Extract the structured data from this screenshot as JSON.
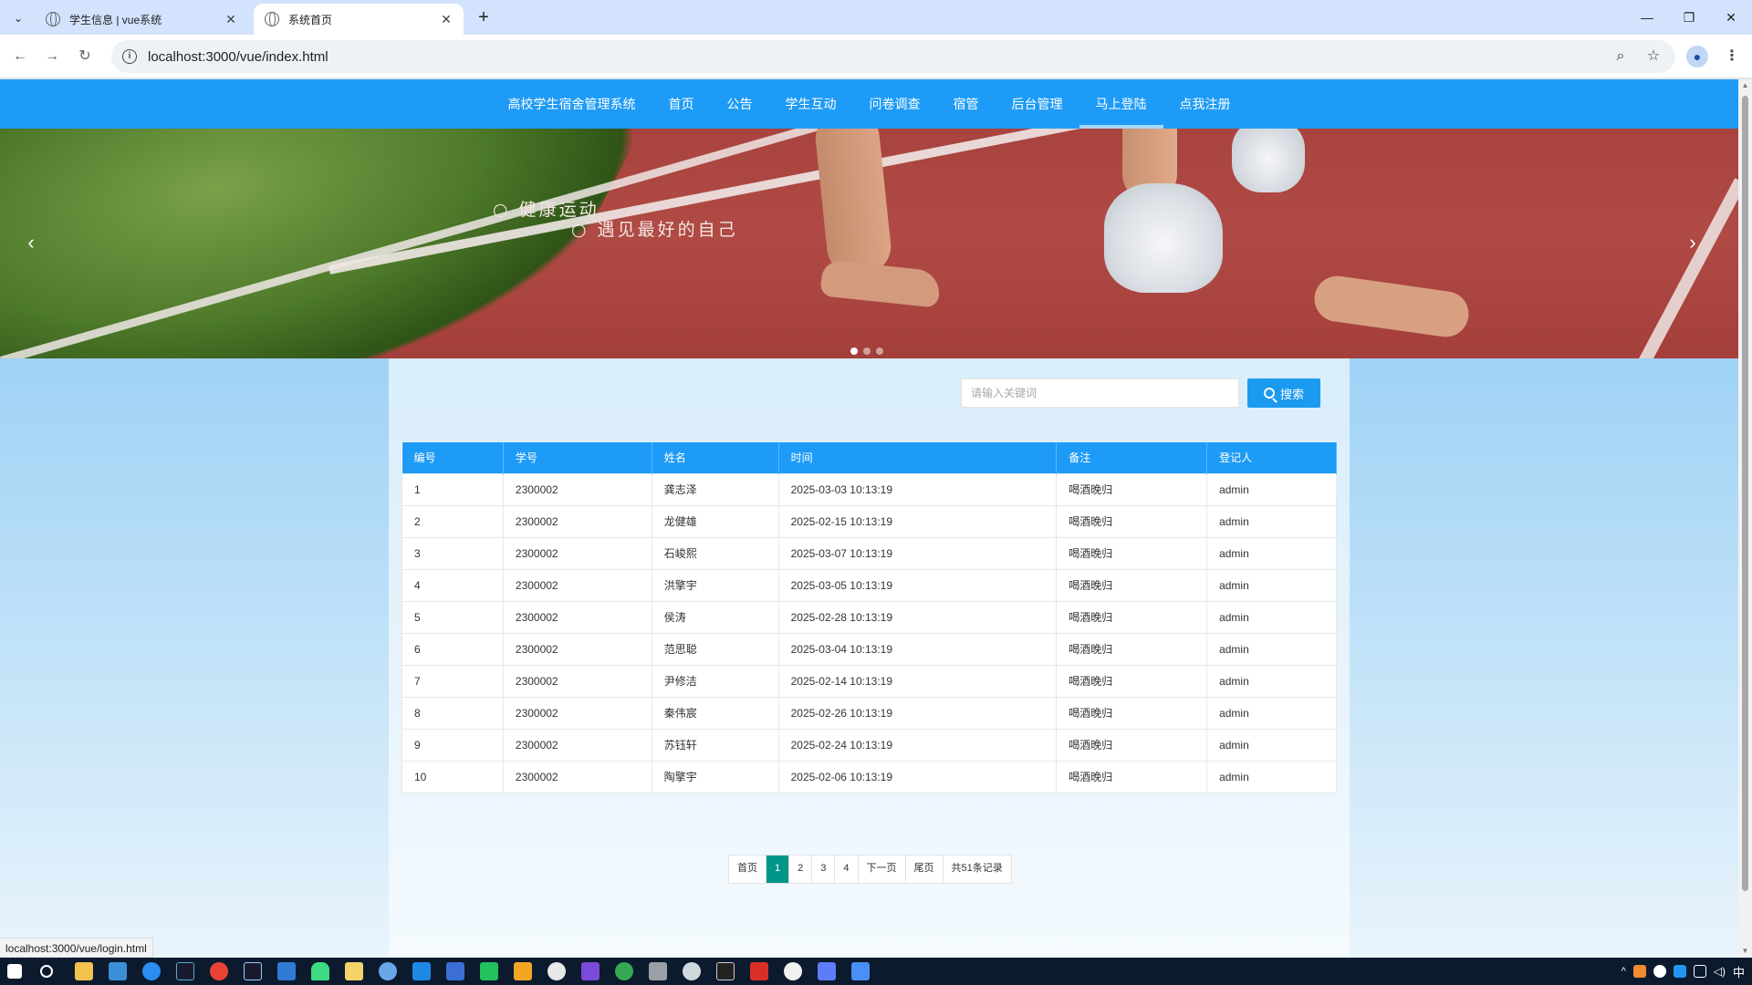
{
  "browser": {
    "tabs": [
      {
        "title": "学生信息 | vue系统",
        "active": false
      },
      {
        "title": "系统首页",
        "active": true
      }
    ],
    "url": "localhost:3000/vue/index.html",
    "status_url": "localhost:3000/vue/login.html"
  },
  "site_nav": {
    "items": [
      "高校学生宿舍管理系统",
      "首页",
      "公告",
      "学生互动",
      "问卷调查",
      "宿管",
      "后台管理",
      "马上登陆",
      "点我注册"
    ],
    "current_index": 7
  },
  "banner": {
    "slogan1": "○ 健康运动",
    "slogan2": "○ 遇见最好的自己",
    "slide_count": 3,
    "active_slide": 0
  },
  "search": {
    "placeholder": "请输入关键词",
    "button_label": "搜索"
  },
  "table": {
    "headers": [
      "编号",
      "学号",
      "姓名",
      "时间",
      "备注",
      "登记人"
    ],
    "rows": [
      [
        "1",
        "2300002",
        "龚志泽",
        "2025-03-03 10:13:19",
        "喝酒晚归",
        "admin"
      ],
      [
        "2",
        "2300002",
        "龙健雄",
        "2025-02-15 10:13:19",
        "喝酒晚归",
        "admin"
      ],
      [
        "3",
        "2300002",
        "石峻熙",
        "2025-03-07 10:13:19",
        "喝酒晚归",
        "admin"
      ],
      [
        "4",
        "2300002",
        "洪擎宇",
        "2025-03-05 10:13:19",
        "喝酒晚归",
        "admin"
      ],
      [
        "5",
        "2300002",
        "侯涛",
        "2025-02-28 10:13:19",
        "喝酒晚归",
        "admin"
      ],
      [
        "6",
        "2300002",
        "范思聪",
        "2025-03-04 10:13:19",
        "喝酒晚归",
        "admin"
      ],
      [
        "7",
        "2300002",
        "尹修洁",
        "2025-02-14 10:13:19",
        "喝酒晚归",
        "admin"
      ],
      [
        "8",
        "2300002",
        "秦伟宸",
        "2025-02-26 10:13:19",
        "喝酒晚归",
        "admin"
      ],
      [
        "9",
        "2300002",
        "苏钰轩",
        "2025-02-24 10:13:19",
        "喝酒晚归",
        "admin"
      ],
      [
        "10",
        "2300002",
        "陶擎宇",
        "2025-02-06 10:13:19",
        "喝酒晚归",
        "admin"
      ]
    ]
  },
  "pagination": {
    "first": "首页",
    "pages": [
      "1",
      "2",
      "3",
      "4"
    ],
    "current_page": "1",
    "next": "下一页",
    "last": "尾页",
    "total": "共51条记录"
  },
  "colors": {
    "nav_bg": "#1e9bf6",
    "search_button": "#1c9af0",
    "pager_current": "#009688"
  },
  "taskbar": {
    "ime_label": "中"
  }
}
